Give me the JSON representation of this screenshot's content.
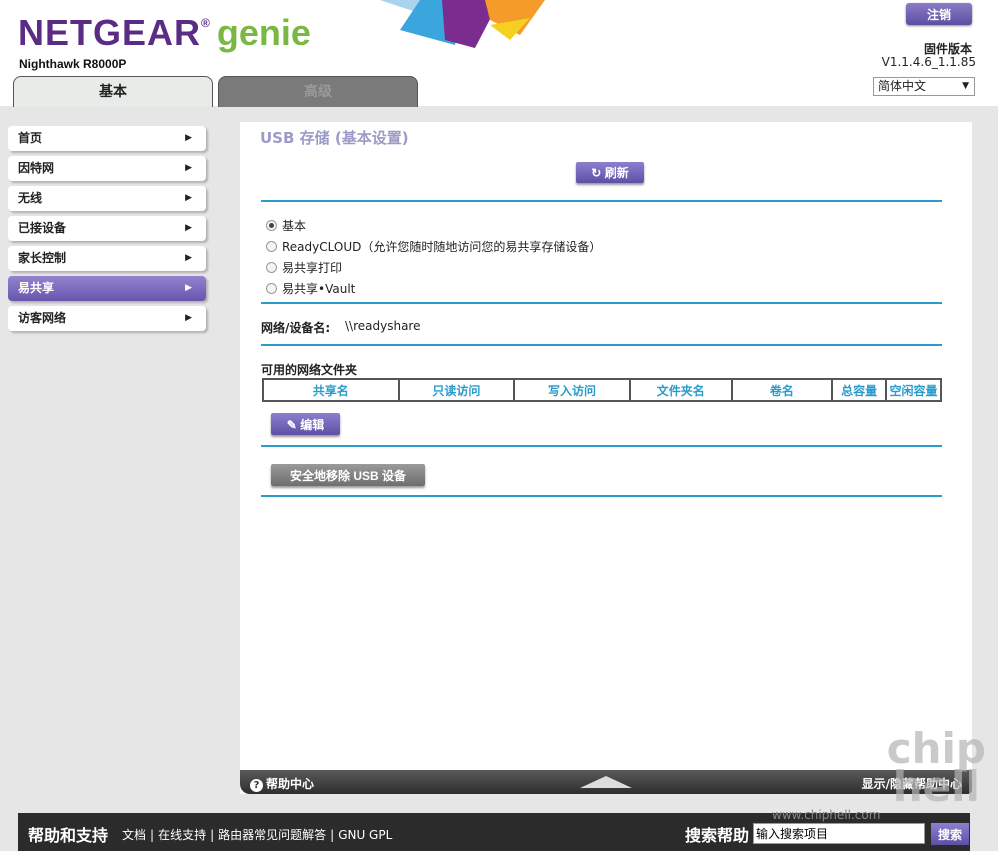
{
  "header": {
    "logo_brand": "NETGEAR",
    "logo_reg": "®",
    "logo_product": "genie",
    "model": "Nighthawk R8000P",
    "logout_label": "注销",
    "firmware_label": "固件版本",
    "firmware_version": "V1.1.4.6_1.1.85",
    "language_selected": "简体中文",
    "brand_color": "#5b2c83",
    "accent_color": "#7ab844"
  },
  "tabs": [
    {
      "label": "基本",
      "active": true
    },
    {
      "label": "高级",
      "active": false
    }
  ],
  "sidebar": {
    "items": [
      {
        "label": "首页",
        "active": false
      },
      {
        "label": "因特网",
        "active": false
      },
      {
        "label": "无线",
        "active": false
      },
      {
        "label": "已接设备",
        "active": false
      },
      {
        "label": "家长控制",
        "active": false
      },
      {
        "label": "易共享",
        "active": true
      },
      {
        "label": "访客网络",
        "active": false
      }
    ],
    "arrow_icon": "▶"
  },
  "main": {
    "title": "USB 存储 (基本设置)",
    "refresh_label": "刷新",
    "options": [
      {
        "label": "基本",
        "selected": true
      },
      {
        "label": "ReadyCLOUD（允许您随时随地访问您的易共享存储设备）",
        "selected": false
      },
      {
        "label": "易共享打印",
        "selected": false
      },
      {
        "label": "易共享•Vault",
        "selected": false
      }
    ],
    "device_name_label": "网络/设备名:",
    "device_name_value": "\\\\readyshare",
    "folders_title": "可用的网络文件夹",
    "table_headers": [
      "共享名",
      "只读访问",
      "写入访问",
      "文件夹名",
      "卷名",
      "总容量",
      "空闲容量"
    ],
    "edit_label": "编辑",
    "remove_usb_label": "安全地移除 USB 设备",
    "line_color": "#2a9ccc"
  },
  "help_bar": {
    "left_label": "帮助中心",
    "right_label": "显示/隐藏帮助中心"
  },
  "footer": {
    "title": "帮助和支持",
    "links": [
      "文档",
      "在线支持",
      "路由器常见问题解答",
      "GNU GPL"
    ],
    "search_label": "搜索帮助",
    "search_value": "输入搜索项目",
    "search_button": "搜索"
  },
  "watermark": {
    "line1": "chip",
    "line2": "hell",
    "url": "www.chiphell.com"
  }
}
